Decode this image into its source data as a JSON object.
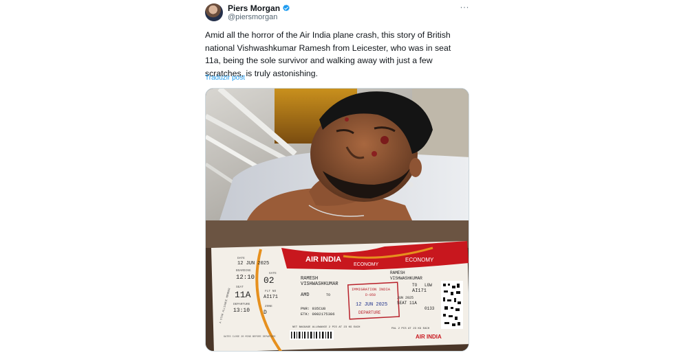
{
  "author": {
    "display_name": "Piers Morgan",
    "handle": "@piersmorgan",
    "verified_color": "#1d9bf0"
  },
  "tweet": {
    "text": "Amid all the horror of the Air India plane crash, this story of British national Vishwashkumar Ramesh from Leicester, who was in seat 11a, being the sole survivor and walking away with just a few scratches, is truly astonishing.",
    "translate_label": "Traduzir post",
    "more_label": "···"
  },
  "boarding_pass": {
    "airline": "AIR INDIA",
    "cabin": "ECONOMY",
    "date_label": "DATE",
    "date": "12 JUN 2025",
    "boarding_label": "BOARDING",
    "boarding_time": "12:10",
    "gate_label": "GATE",
    "gate": "02",
    "seat_label": "SEAT",
    "seat": "11A",
    "flight_label": "FLT NO",
    "flight": "AI171",
    "departure_label": "DEPARTURE",
    "departure_time": "13:10",
    "zone_label": "ZONE",
    "zone": "D",
    "passenger_name_line1": "RAMESH",
    "passenger_name_line2": "VISHWASHKUMAR",
    "from_code": "AMD",
    "to_label": "TO",
    "to_code": "LGW",
    "pnr": "PNR: 935CU8",
    "etk": "ETK: 0982175386",
    "baggage": "NET BAGGAGE ALLOWANCE 2 PCS AT 23 KG EACH",
    "stub_date": "JUN 2025",
    "stub_seat": "SEAT 11A",
    "stub_gate_code": "0133",
    "stub_baggage": "PAL 2 PCS AT 23 KG EACH",
    "stamp_title": "IMMIGRATION INDIA",
    "stamp_code": "D-050",
    "stamp_date": "12 JUN 2025",
    "stamp_bottom": "DEPARTURE",
    "star_alliance": "A STAR ALLIANCE MEMBER",
    "gate_close": "GATES CLOSE 20 MINS BEFORE DEPARTURE"
  }
}
